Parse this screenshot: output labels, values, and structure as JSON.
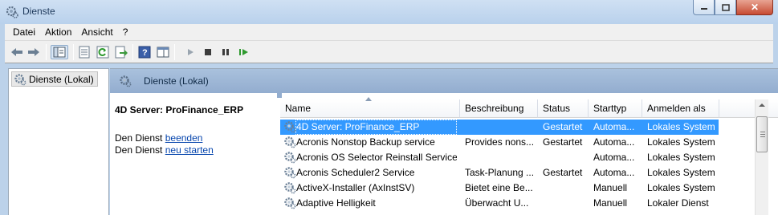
{
  "window": {
    "title": "Dienste"
  },
  "menu": [
    "Datei",
    "Aktion",
    "Ansicht",
    "?"
  ],
  "tree": {
    "root_label": "Dienste (Lokal)"
  },
  "main": {
    "header_title": "Dienste (Lokal)",
    "detail": {
      "service_name": "4D Server: ProFinance_ERP",
      "stop_prefix": "Den Dienst",
      "stop_link": "beenden",
      "restart_prefix": "Den Dienst",
      "restart_link": "neu starten"
    }
  },
  "table": {
    "columns": [
      "Name",
      "Beschreibung",
      "Status",
      "Starttyp",
      "Anmelden als"
    ],
    "rows": [
      {
        "name": "4D Server: ProFinance_ERP",
        "description": "",
        "status": "Gestartet",
        "starttype": "Automa...",
        "logon": "Lokales System",
        "selected": true
      },
      {
        "name": "Acronis Nonstop Backup service",
        "description": "Provides nons...",
        "status": "Gestartet",
        "starttype": "Automa...",
        "logon": "Lokales System"
      },
      {
        "name": "Acronis OS Selector Reinstall Service",
        "description": "",
        "status": "",
        "starttype": "Automa...",
        "logon": "Lokales System"
      },
      {
        "name": "Acronis Scheduler2 Service",
        "description": "Task-Planung ...",
        "status": "Gestartet",
        "starttype": "Automa...",
        "logon": "Lokales System"
      },
      {
        "name": "ActiveX-Installer (AxInstSV)",
        "description": "Bietet eine Be...",
        "status": "",
        "starttype": "Manuell",
        "logon": "Lokales System"
      },
      {
        "name": "Adaptive Helligkeit",
        "description": "Überwacht U...",
        "status": "",
        "starttype": "Manuell",
        "logon": "Lokaler Dienst"
      }
    ]
  },
  "colors": {
    "selection": "#3399ff",
    "header_band": "#a9c1dd",
    "link": "#0645ad"
  }
}
